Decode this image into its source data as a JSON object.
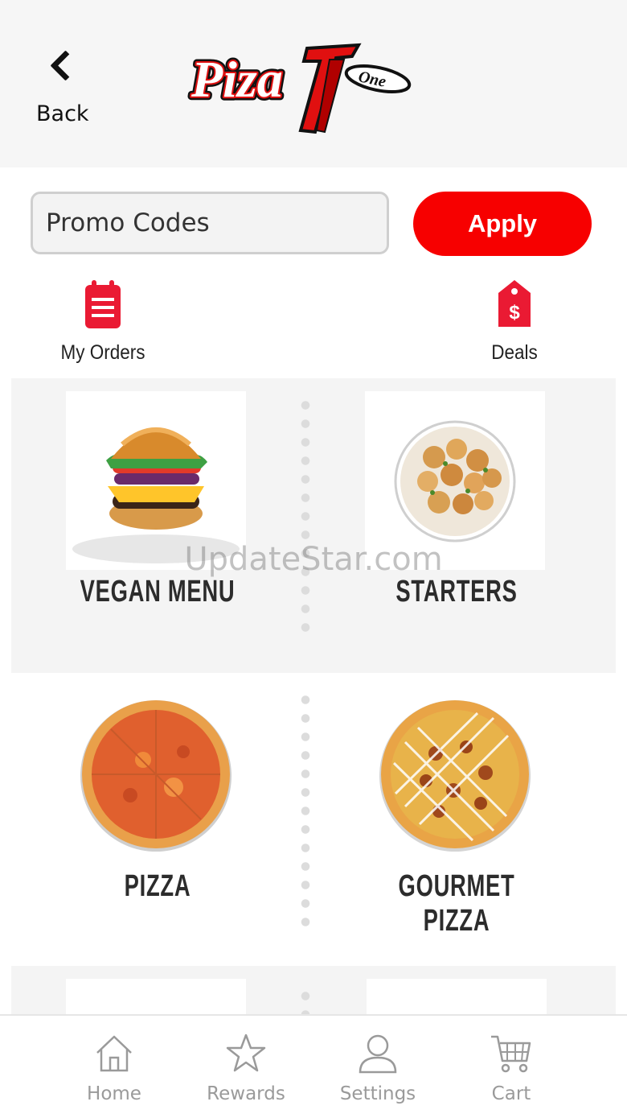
{
  "header": {
    "back_label": "Back",
    "logo_text": "Piza One"
  },
  "promo": {
    "placeholder": "Promo Codes",
    "apply_label": "Apply"
  },
  "quick_actions": {
    "orders_label": "My Orders",
    "deals_label": "Deals"
  },
  "categories": [
    {
      "label": "VEGAN MENU",
      "image": "burger"
    },
    {
      "label": "STARTERS",
      "image": "garlic-knots"
    },
    {
      "label": "PIZZA",
      "image": "cheese-pizza"
    },
    {
      "label": "GOURMET PIZZA",
      "image": "gourmet-pizza"
    }
  ],
  "watermark": "UpdateStar.com",
  "tabs": [
    {
      "label": "Home",
      "icon": "home-icon"
    },
    {
      "label": "Rewards",
      "icon": "star-icon"
    },
    {
      "label": "Settings",
      "icon": "user-icon"
    },
    {
      "label": "Cart",
      "icon": "cart-icon"
    }
  ],
  "colors": {
    "accent": "#f70000",
    "tab_inactive": "#9a9a9a",
    "header_bg": "#f6f6f6"
  }
}
